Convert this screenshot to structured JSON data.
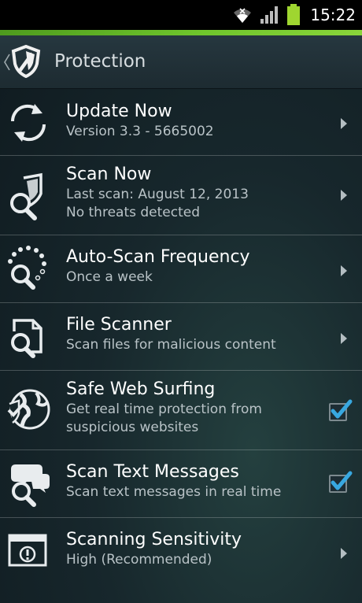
{
  "status_bar": {
    "time": "15:22",
    "icons": [
      "wifi-icon",
      "signal-icon",
      "battery-icon"
    ]
  },
  "header": {
    "title": "Protection",
    "logo_icon": "shield-icon",
    "back_icon": "chevron-left-icon"
  },
  "colors": {
    "accent_green": "#6fc52c",
    "checkbox_blue": "#38a8e0"
  },
  "items": [
    {
      "title": "Update Now",
      "subtitle": "Version 3.3 - 5665002",
      "icon": "refresh-icon",
      "control": "chevron"
    },
    {
      "title": "Scan Now",
      "subtitle": "Last scan: August 12, 2013",
      "subtitle2": "No threats detected",
      "icon": "scan-search-icon",
      "control": "chevron"
    },
    {
      "title": "Auto-Scan Frequency",
      "subtitle": "Once a week",
      "icon": "schedule-search-icon",
      "control": "chevron"
    },
    {
      "title": "File Scanner",
      "subtitle": "Scan files for malicious content",
      "icon": "file-search-icon",
      "control": "chevron"
    },
    {
      "title": "Safe Web Surfing",
      "subtitle": "Get real time protection from",
      "subtitle2": "suspicious websites",
      "icon": "globe-shield-icon",
      "control": "checkbox",
      "checked": true
    },
    {
      "title": "Scan Text Messages",
      "subtitle": "Scan text messages in real time",
      "icon": "message-search-icon",
      "control": "checkbox",
      "checked": true
    },
    {
      "title": "Scanning Sensitivity",
      "subtitle": "High (Recommended)",
      "icon": "window-alert-icon",
      "control": "chevron"
    }
  ]
}
